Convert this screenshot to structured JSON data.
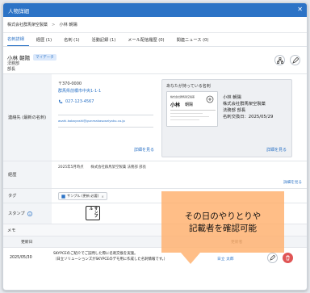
{
  "window": {
    "title": "人物詳細",
    "close": "✕"
  },
  "breadcrumb": {
    "company": "株式会社群馬架空製薬",
    "separator": ">",
    "person": "小林 朝陽"
  },
  "tabs": [
    "名刺詳細",
    "経歴 (1)",
    "名刺 (1)",
    "活動記録 (1)",
    "メール配信履歴 (0)",
    "関連ニュース (0)"
  ],
  "person": {
    "name": "小林 朝陽",
    "badge": "マイデータ",
    "department": "法務部",
    "position": "部長"
  },
  "contact": {
    "label": "連絡先 (最新の名刺)",
    "postal": "〒370-0000",
    "address": "群馬県前橋市中央1-1-1",
    "phone": "027-123-4567",
    "email": "asahi.kobayashi@gunmakasoseiyaku.co.jp",
    "detail_link": "詳細を見る"
  },
  "card": {
    "caption": "あなたが持っている名刺",
    "name": "小林 朝陽",
    "company": "株式会社群馬架空製薬",
    "dept": "法務部 部長",
    "date": "名刺交換日：2025/05/29",
    "detail_link": "詳細を見る",
    "img_name": "小林",
    "img_sub": "朝陽"
  },
  "career": {
    "label": "経歴",
    "entry": "2025年5月時点　　株式会社群馬架空製薬 法務部 部長",
    "detail_link": "詳細を見る"
  },
  "tag": {
    "label": "タグ",
    "chip": "サンプル (更新 必要)"
  },
  "stamp": {
    "label": "スタンプ",
    "text": "サンプル"
  },
  "memo": {
    "label": "メモ"
  },
  "activity": {
    "headers": {
      "date": "更新日",
      "updater": "更新者"
    },
    "row": {
      "date": "2025/05/30",
      "line1": "SKYPCEのご紹介でご訪問した際に名刺交換を実施。",
      "line2": "（日立ソリューションズがSKYPCEのデモ用に作成した名刺情報です。）",
      "updater": "日立 太郎"
    }
  },
  "callout": {
    "line1": "その日のやりとりや",
    "line2": "記載者を確認可能"
  },
  "colors": {
    "primary": "#2c73c6",
    "callout": "#ffb06d",
    "delete": "#e05555"
  }
}
